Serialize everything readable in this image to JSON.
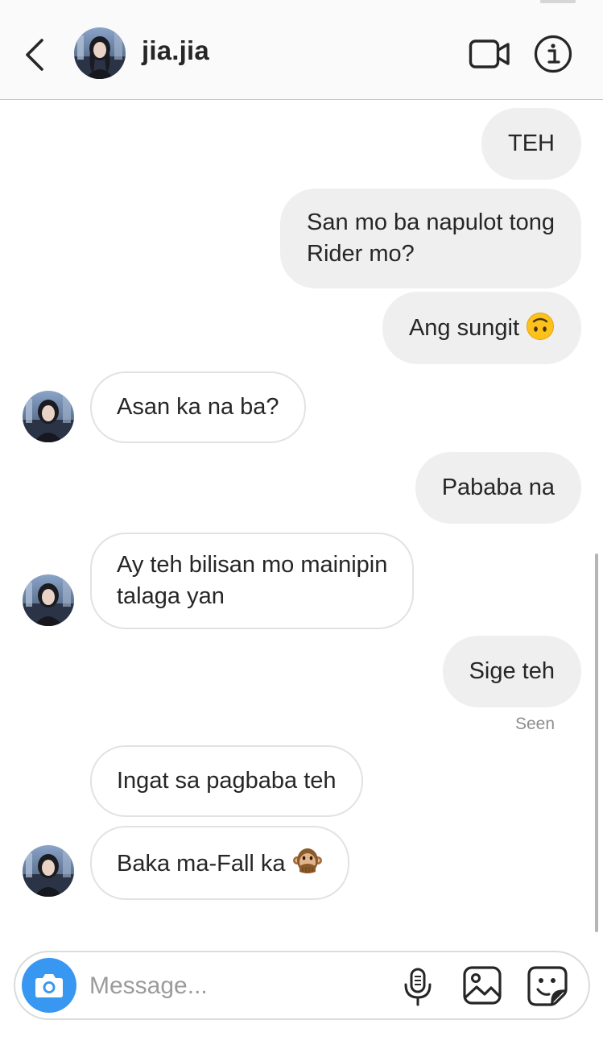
{
  "header": {
    "username": "jia.jia"
  },
  "conversation": {
    "messages": [
      {
        "direction": "outgoing",
        "text": "TEH"
      },
      {
        "direction": "outgoing",
        "text": "San mo ba napulot tong",
        "text_line2": "Rider mo?"
      },
      {
        "direction": "outgoing",
        "text": "Ang sungit",
        "emoji": "upside-down-face"
      },
      {
        "direction": "incoming",
        "text": "Asan ka na ba?"
      },
      {
        "direction": "outgoing",
        "text": "Pababa na"
      },
      {
        "direction": "incoming",
        "text": "Ay teh bilisan mo mainipin",
        "text_line2": "talaga yan"
      },
      {
        "direction": "outgoing",
        "text": "Sige teh"
      },
      {
        "direction": "incoming",
        "text": "Ingat sa pagbaba teh"
      },
      {
        "direction": "incoming",
        "text": "Baka ma-Fall ka",
        "emoji": "speak-no-evil-monkey"
      }
    ],
    "seen_label": "Seen"
  },
  "composer": {
    "placeholder": "Message..."
  },
  "colors": {
    "accent": "#3897f0",
    "outgoing_bubble": "#efefef",
    "incoming_border": "#e2e2e2",
    "meta_text": "#8e8e8e"
  },
  "icons": {
    "back": "chevron-left-icon",
    "video": "video-camera-icon",
    "info": "info-icon",
    "camera": "camera-icon",
    "mic": "microphone-icon",
    "gallery": "image-gallery-icon",
    "sticker": "sticker-icon"
  }
}
